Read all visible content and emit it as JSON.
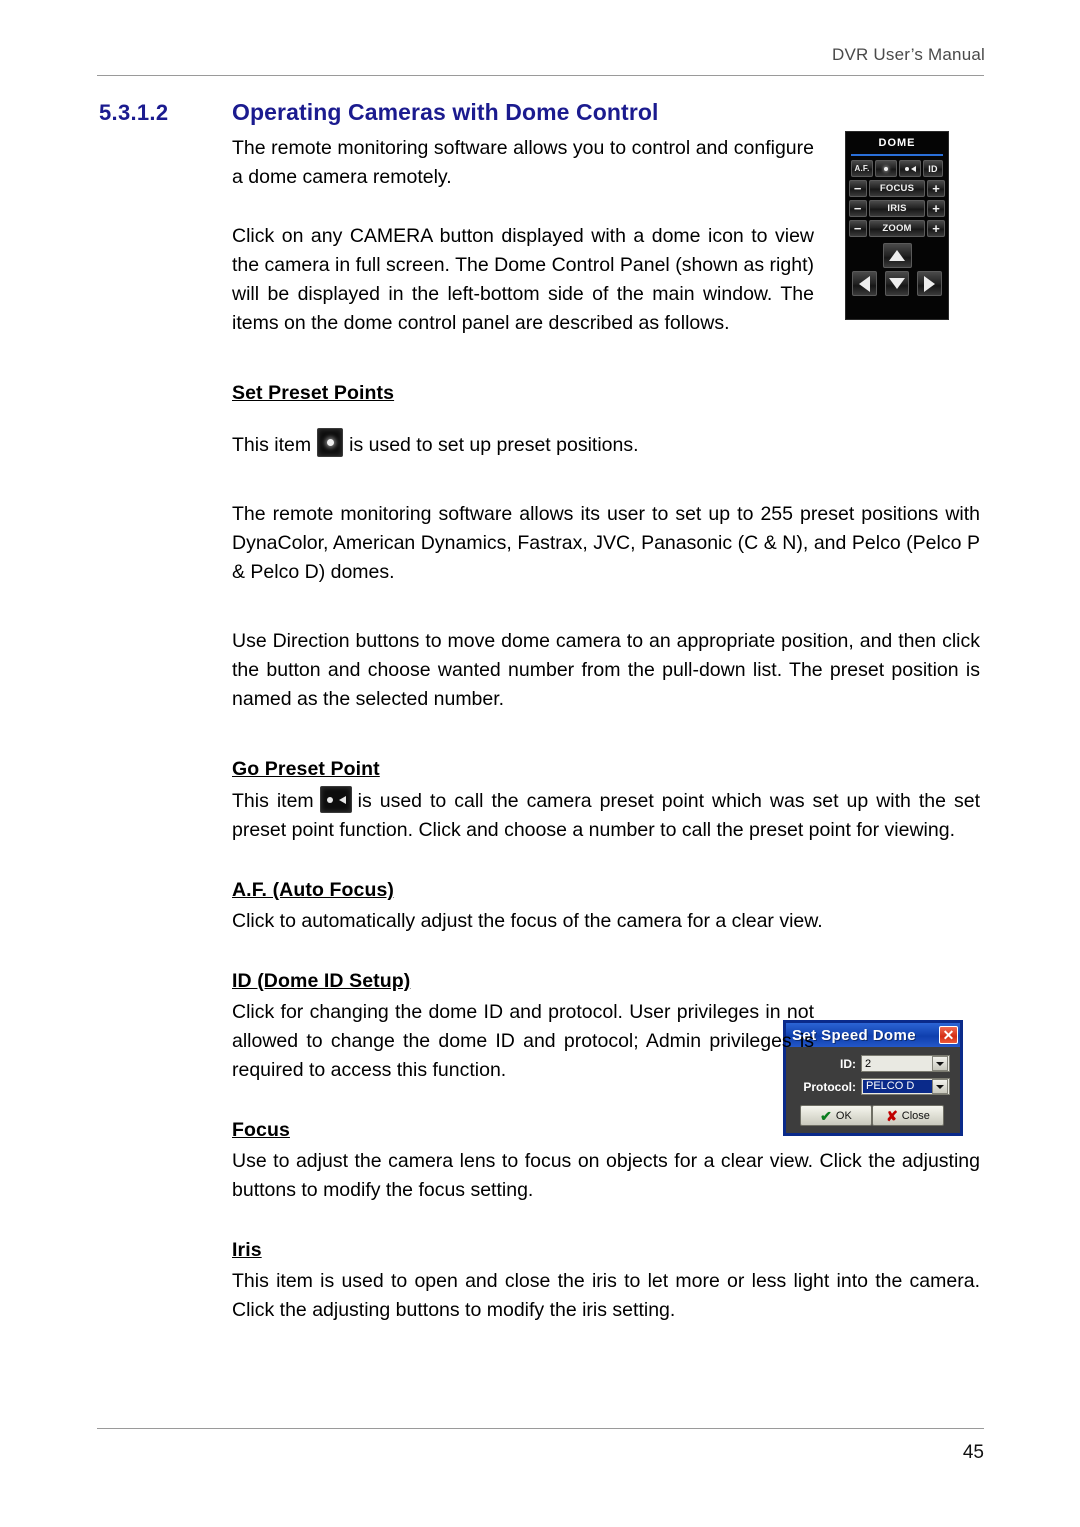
{
  "header": {
    "manual_title": "DVR User’s Manual"
  },
  "footer": {
    "page_number": "45"
  },
  "section": {
    "number": "5.3.1.2",
    "title": "Operating Cameras with Dome Control"
  },
  "intro": {
    "paragraph1": "The remote monitoring software allows you to control and configure a dome camera remotely.",
    "paragraph2": "Click on any CAMERA button displayed with a dome icon to view the camera in full screen. The Dome Control Panel (shown as right) will be displayed in the left-bottom side of the main window. The items on the dome control panel are described as follows."
  },
  "sections": {
    "set_preset_points": {
      "heading": "Set Preset Points",
      "line_before_icon": "This item",
      "line_after_icon": "is used to set up preset positions.",
      "paragraph_255": "The remote monitoring software allows its user to set up to 255 preset positions with DynaColor, American Dynamics, Fastrax, JVC, Panasonic (C & N), and Pelco (Pelco P & Pelco D) domes.",
      "paragraph_direction": "Use Direction buttons to move dome camera to an appropriate position, and then click the button and choose wanted number from the pull-down list. The preset position is named as the selected number."
    },
    "go_preset_point": {
      "heading": "Go Preset Point",
      "line_before_icon": "This item",
      "line_after_icon": "is used to call the camera preset point which was set up with the set preset point function. Click and choose a number to call the preset point for viewing."
    },
    "auto_focus": {
      "heading": "A.F. (Auto Focus)",
      "body": "Click to automatically adjust the focus of the camera for a clear view."
    },
    "dome_id_setup": {
      "heading": "ID (Dome ID Setup)",
      "body": "Click for changing the dome ID and protocol. User privileges in not allowed to change the dome ID and protocol; Admin privileges is required to access this function."
    },
    "focus": {
      "heading": "Focus",
      "body": "Use to adjust the camera lens to focus on objects for a clear view. Click the adjusting buttons to modify the focus setting."
    },
    "iris": {
      "heading": "Iris",
      "body": "This item is used to open and close the iris to let more or less light into the camera. Click the adjusting buttons to modify the iris setting."
    }
  },
  "dome_panel": {
    "title": "DOME",
    "buttons": {
      "auto_focus": "A.F.",
      "set_preset": "",
      "go_preset": "",
      "id": "ID",
      "minus": "−",
      "plus": "+",
      "focus": "FOCUS",
      "iris": "IRIS",
      "zoom": "ZOOM"
    },
    "accent_color": "#2a6fd8"
  },
  "speed_dome_dialog": {
    "title": "Set Speed Dome",
    "close_glyph": "✕",
    "id_label": "ID:",
    "id_value": "2",
    "protocol_label": "Protocol:",
    "protocol_value": "PELCO D",
    "ok_label": "OK",
    "close_label": "Close",
    "ok_glyph": "✔",
    "cancel_glyph": "✘",
    "title_color": "#0a2a8a"
  }
}
